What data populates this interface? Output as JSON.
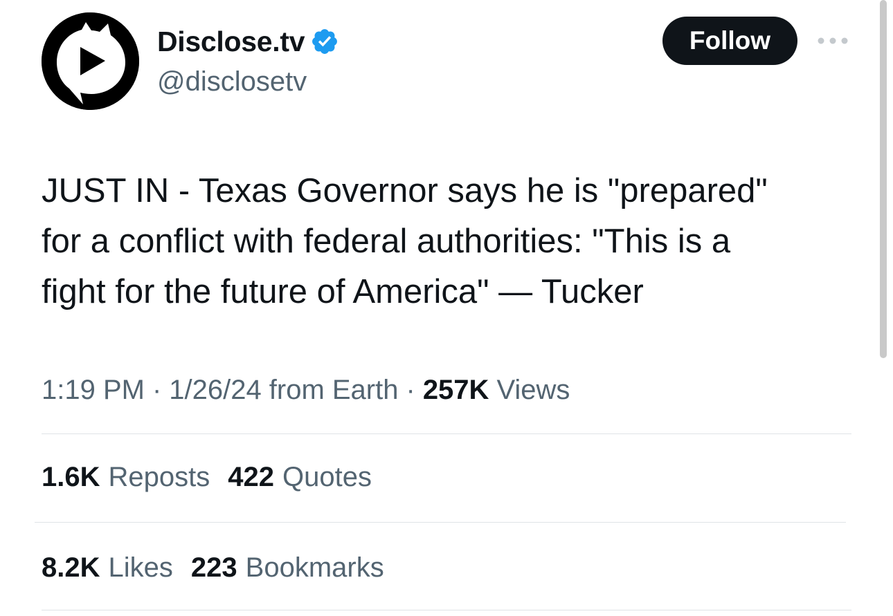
{
  "author": {
    "display_name": "Disclose.tv",
    "handle": "@disclosetv",
    "verified_icon": "verified-badge-icon",
    "avatar_icon": "play-speech-bubble-logo"
  },
  "header": {
    "follow_label": "Follow",
    "more_icon": "more-horizontal-icon"
  },
  "tweet": {
    "text": "JUST IN - Texas Governor says he is \"prepared\"\nfor a conflict with federal authorities: \"This is a\nfight for the future of America\" — Tucker"
  },
  "meta": {
    "time": "1:19 PM",
    "sep1": "·",
    "date": "1/26/24",
    "source": "from Earth",
    "sep2": "·",
    "views_count": "257K",
    "views_label": "Views"
  },
  "stats": {
    "reposts": {
      "count": "1.6K",
      "label": "Reposts"
    },
    "quotes": {
      "count": "422",
      "label": "Quotes"
    },
    "likes": {
      "count": "8.2K",
      "label": "Likes"
    },
    "bookmarks": {
      "count": "223",
      "label": "Bookmarks"
    }
  },
  "colors": {
    "text_primary": "#0f1419",
    "text_secondary": "#536471",
    "verified_blue": "#1d9bf0",
    "divider": "#dfe3e6"
  }
}
